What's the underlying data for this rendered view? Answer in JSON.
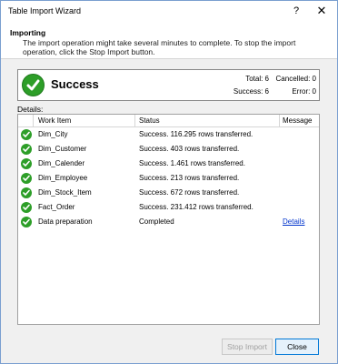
{
  "window": {
    "title": "Table Import Wizard",
    "help_glyph": "?",
    "close_glyph": "✕"
  },
  "header": {
    "title": "Importing",
    "description": "The import operation might take several minutes to complete. To stop the import operation, click the Stop Import button."
  },
  "status": {
    "label": "Success",
    "color": "#2d9e28",
    "total": "Total: 6",
    "cancelled": "Cancelled: 0",
    "success": "Success: 6",
    "error": "Error: 0"
  },
  "details_label": "Details:",
  "table": {
    "columns": [
      "Work Item",
      "Status",
      "Message"
    ],
    "rows": [
      {
        "item": "Dim_City",
        "status": "Success. 116.295 rows transferred.",
        "message": ""
      },
      {
        "item": "Dim_Customer",
        "status": "Success. 403 rows transferred.",
        "message": ""
      },
      {
        "item": "Dim_Calender",
        "status": "Success. 1.461 rows transferred.",
        "message": ""
      },
      {
        "item": "Dim_Employee",
        "status": "Success. 213 rows transferred.",
        "message": ""
      },
      {
        "item": "Dim_Stock_Item",
        "status": "Success. 672 rows transferred.",
        "message": ""
      },
      {
        "item": "Fact_Order",
        "status": "Success. 231.412 rows transferred.",
        "message": ""
      },
      {
        "item": "Data preparation",
        "status": "Completed",
        "message": "Details"
      }
    ]
  },
  "buttons": {
    "stop_import": "Stop Import",
    "close": "Close"
  }
}
